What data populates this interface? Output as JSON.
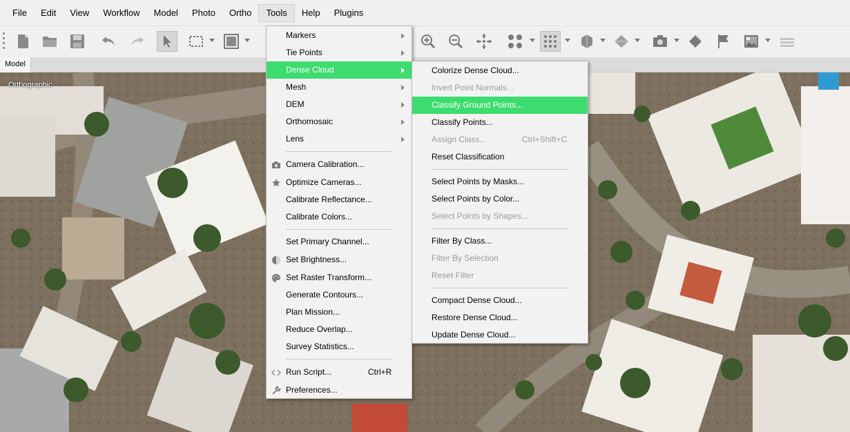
{
  "menubar": {
    "items": [
      "File",
      "Edit",
      "View",
      "Workflow",
      "Model",
      "Photo",
      "Ortho",
      "Tools",
      "Help",
      "Plugins"
    ],
    "active": "Tools"
  },
  "toolbar": {
    "icons": [
      "new-document-icon",
      "open-folder-icon",
      "save-icon",
      "undo-icon",
      "redo-icon",
      "pointer-icon",
      "rectangle-select-icon",
      "resize-region-icon",
      "zoom-in-icon",
      "zoom-out-icon",
      "reset-view-icon",
      "show-points-icon",
      "show-dense-cloud-icon",
      "show-model-icon",
      "show-tiled-model-icon",
      "show-cameras-icon",
      "show-shapes-icon",
      "show-markers-icon",
      "show-images-icon",
      "show-layers-icon"
    ]
  },
  "tabs": {
    "model": "Model"
  },
  "viewport": {
    "projection_label": "Orthographic"
  },
  "tools_menu": {
    "items": [
      {
        "label": "Markers",
        "submenu": true
      },
      {
        "label": "Tie Points",
        "submenu": true
      },
      {
        "label": "Dense Cloud",
        "submenu": true,
        "highlighted": true
      },
      {
        "label": "Mesh",
        "submenu": true
      },
      {
        "label": "DEM",
        "submenu": true
      },
      {
        "label": "Orthomosaic",
        "submenu": true
      },
      {
        "label": "Lens",
        "submenu": true
      },
      {
        "label": "Camera Calibration...",
        "icon": "camera-icon"
      },
      {
        "label": "Optimize Cameras...",
        "icon": "star-icon"
      },
      {
        "label": "Calibrate Reflectance..."
      },
      {
        "label": "Calibrate Colors..."
      },
      {
        "label": "Set Primary Channel..."
      },
      {
        "label": "Set Brightness...",
        "icon": "brightness-icon"
      },
      {
        "label": "Set Raster Transform...",
        "icon": "palette-icon"
      },
      {
        "label": "Generate Contours..."
      },
      {
        "label": "Plan Mission..."
      },
      {
        "label": "Reduce Overlap..."
      },
      {
        "label": "Survey Statistics..."
      },
      {
        "label": "Run Script...",
        "shortcut": "Ctrl+R",
        "icon": "script-icon"
      },
      {
        "label": "Preferences...",
        "icon": "wrench-icon"
      }
    ]
  },
  "dense_cloud_menu": {
    "items": [
      {
        "label": "Colorize Dense Cloud..."
      },
      {
        "label": "Invert Point Normals...",
        "disabled": true
      },
      {
        "label": "Classify Ground Points...",
        "highlighted": true
      },
      {
        "label": "Classify Points..."
      },
      {
        "label": "Assign Class...",
        "shortcut": "Ctrl+Shift+C",
        "disabled": true
      },
      {
        "label": "Reset Classification"
      },
      {
        "label": "Select Points by Masks..."
      },
      {
        "label": "Select Points by Color..."
      },
      {
        "label": "Select Points by Shapes...",
        "disabled": true
      },
      {
        "label": "Filter By Class..."
      },
      {
        "label": "Filter By Selection",
        "disabled": true
      },
      {
        "label": "Reset Filter",
        "disabled": true
      },
      {
        "label": "Compact Dense Cloud..."
      },
      {
        "label": "Restore Dense Cloud..."
      },
      {
        "label": "Update Dense Cloud..."
      }
    ]
  },
  "colors": {
    "highlight": "#3ddc6e",
    "menu_bg": "#f2f2f2",
    "disabled_text": "#9a9a9a"
  }
}
